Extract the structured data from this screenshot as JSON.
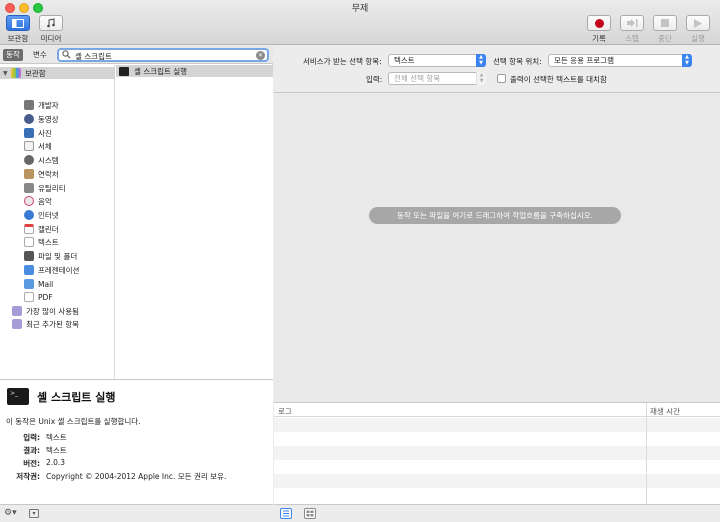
{
  "window": {
    "title": "무제"
  },
  "toolbar": {
    "library_label": "보관함",
    "media_label": "미디어",
    "record_label": "기록",
    "step_label": "스텝",
    "stop_label": "중단",
    "run_label": "실행"
  },
  "search": {
    "tab_actions": "동작",
    "tab_variables": "변수",
    "value": "셸 스크립트"
  },
  "library": {
    "root": "보관함",
    "items": [
      "개발자",
      "동영상",
      "사진",
      "서체",
      "시스템",
      "연락처",
      "유틸리티",
      "음악",
      "인터넷",
      "캘린더",
      "텍스트",
      "파일 및 폴더",
      "프레젠테이션",
      "Mail",
      "PDF"
    ],
    "smart_groups": [
      "가장 많이 사용됨",
      "최근 추가된 항목"
    ]
  },
  "actions": {
    "items": [
      "셸 스크립트 실행"
    ]
  },
  "description": {
    "title": "셸 스크립트 실행",
    "summary": "이 동작은 Unix 셸 스크립트를 실행합니다.",
    "fields": [
      {
        "key": "입력:",
        "value": "텍스트"
      },
      {
        "key": "결과:",
        "value": "텍스트"
      },
      {
        "key": "버전:",
        "value": "2.0.3"
      },
      {
        "key": "저작권:",
        "value": "Copyright © 2004-2012 Apple Inc.  모든 권리 보유."
      }
    ]
  },
  "workflow": {
    "service_label": "서비스가 받는 선택 항목:",
    "service_value": "텍스트",
    "location_label": "선택 항목 위치:",
    "location_value": "모든 응용 프로그램",
    "input_label": "입력:",
    "input_value": "전체 선택 항목",
    "replace_label": "출력이 선택한 텍스트를 대치함",
    "hint": "동작 또는 파일을 여기로 드래그하여 작업흐름을 구축하십시오."
  },
  "log": {
    "col_log": "로그",
    "col_duration": "재생 시간"
  },
  "colors": {
    "accent": "#3a84f0",
    "record": "#c4001a"
  }
}
